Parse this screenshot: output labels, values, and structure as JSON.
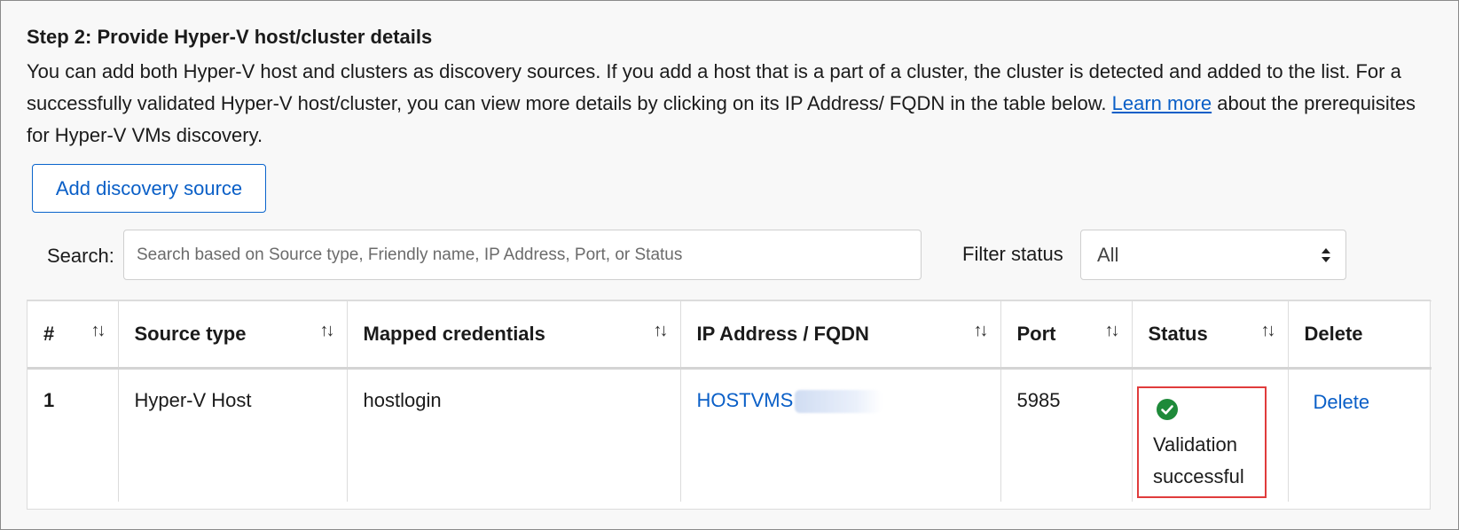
{
  "heading": "Step 2: Provide Hyper-V host/cluster details",
  "description": {
    "before_link": "You can add both Hyper-V host and clusters as discovery sources. If you add a host that is a part of a cluster, the cluster is detected and added to the list. For a successfully validated Hyper-V host/cluster, you can view more details by clicking on its IP Address/ FQDN in the table below. ",
    "link_text": "Learn more",
    "after_link": " about the prerequisites for Hyper-V VMs discovery."
  },
  "add_button_label": "Add discovery source",
  "search": {
    "label": "Search:",
    "placeholder": "Search based on Source type, Friendly name, IP Address, Port, or Status"
  },
  "filter": {
    "label": "Filter status",
    "selected": "All"
  },
  "table": {
    "headers": {
      "num": "#",
      "source_type": "Source type",
      "mapped_credentials": "Mapped credentials",
      "ip_fqdn": "IP Address / FQDN",
      "port": "Port",
      "status": "Status",
      "delete": "Delete"
    },
    "sort_glyph": "↑↓",
    "rows": [
      {
        "num": "1",
        "source_type": "Hyper-V Host",
        "mapped_credentials": "hostlogin",
        "ip_fqdn": "HOSTVMS",
        "port": "5985",
        "status": "Validation successful",
        "delete": "Delete"
      }
    ]
  },
  "colors": {
    "link": "#0a5fc7",
    "success": "#1e8a3a",
    "highlight": "#e03c3c"
  },
  "icons": [
    "sort-icon",
    "success-check-icon",
    "select-arrows-icon"
  ]
}
